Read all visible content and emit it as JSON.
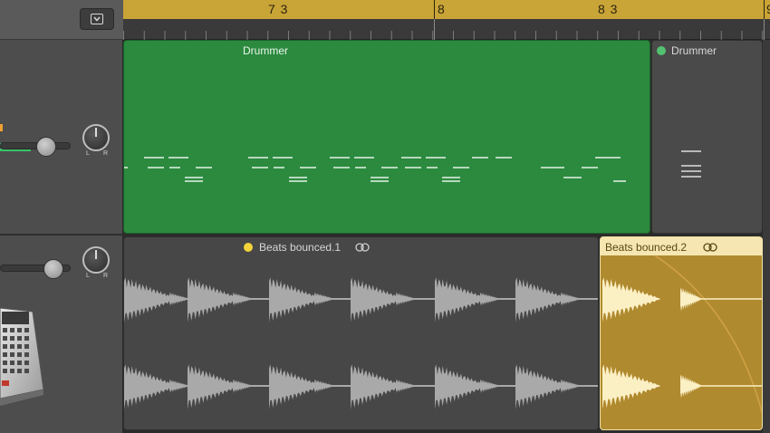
{
  "ruler": {
    "labels": [
      "7 3",
      "8",
      "8 3",
      "9"
    ]
  },
  "tracks": {
    "drummer": {
      "region_label": "Drummer",
      "region2_label": "Drummer",
      "pan_left": "L",
      "pan_right": "R",
      "color": "#2b8a3e"
    },
    "beats": {
      "region_label": "Beats bounced.1",
      "region2_label": "Beats bounced.2",
      "pan_left": "L",
      "pan_right": "R",
      "dot1_color": "#f2d33b",
      "region2_color": "#b08a2f"
    }
  },
  "icons": {
    "dropdown": "chevron-down-box-icon",
    "loop": "loop-icon",
    "drum_machine": "drum-machine-icon"
  }
}
